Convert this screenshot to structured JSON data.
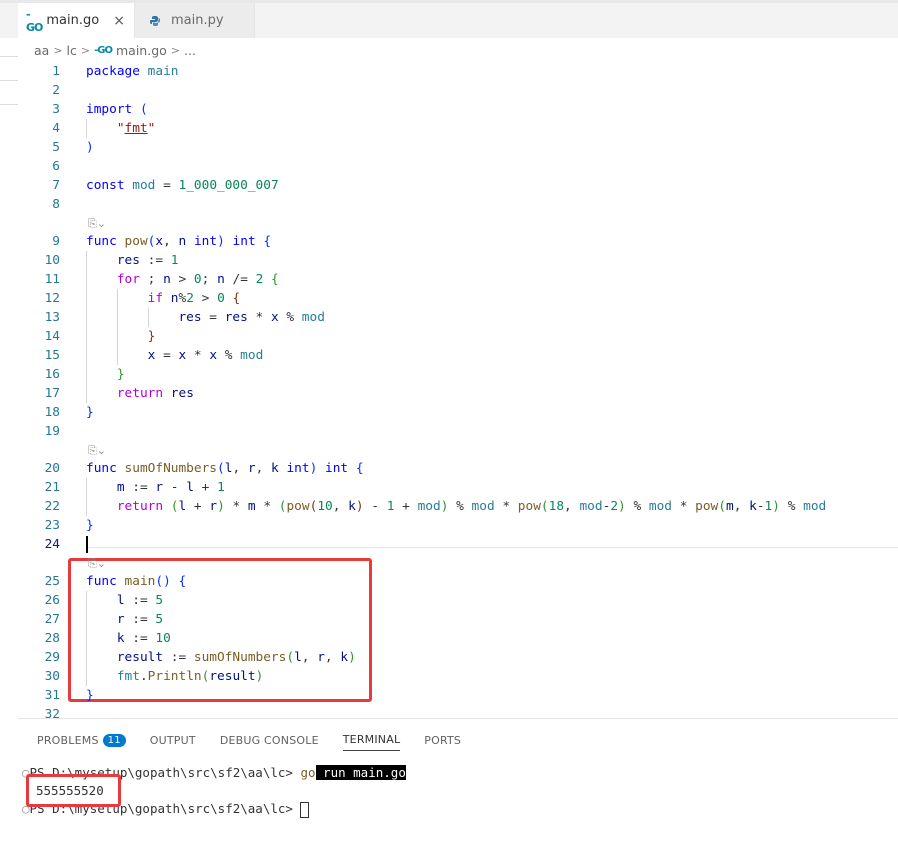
{
  "tabs": [
    {
      "icon": "go-file-icon",
      "icon_text": "-GO",
      "label": "main.go",
      "close": "×"
    },
    {
      "icon": "python-file-icon",
      "label": "main.py"
    }
  ],
  "breadcrumb": {
    "items": [
      "aa",
      "lc",
      "main.go",
      "..."
    ],
    "go_icon_text": "-GO",
    "sep": ">"
  },
  "codelens": {
    "icon_text": "⎘⌄"
  },
  "code_lines": [
    {
      "n": "1",
      "html": "<span class='kw'>package</span> <span class='typ'>main</span>"
    },
    {
      "n": "2",
      "html": ""
    },
    {
      "n": "3",
      "html": "<span class='kw'>import</span> <span class='br1'>(</span>"
    },
    {
      "n": "4",
      "html": "    <span class='str'>\"<u>fmt</u>\"</span>"
    },
    {
      "n": "5",
      "html": "<span class='br1'>)</span>"
    },
    {
      "n": "6",
      "html": ""
    },
    {
      "n": "7",
      "html": "<span class='kw'>const</span> <span class='typ'>mod</span> = <span class='num'>1_000_000_007</span>"
    },
    {
      "n": "8",
      "html": ""
    },
    {
      "n": "9",
      "html": "<span class='kw'>func</span> <span class='fn'>pow</span><span class='br1'>(</span><span class='var'>x</span>, <span class='var'>n</span> <span class='kw'>int</span><span class='br1'>)</span> <span class='kw'>int</span> <span class='br1'>{</span>"
    },
    {
      "n": "10",
      "html": "    <span class='var'>res</span> := <span class='num'>1</span>"
    },
    {
      "n": "11",
      "html": "    <span class='ctl'>for</span> ; <span class='var'>n</span> &gt; <span class='num'>0</span>; <span class='var'>n</span> /= <span class='num'>2</span> <span class='br2'>{</span>"
    },
    {
      "n": "12",
      "html": "        <span class='ctl'>if</span> <span class='var'>n</span>%<span class='num'>2</span> &gt; <span class='num'>0</span> <span class='br3'>{</span>"
    },
    {
      "n": "13",
      "html": "            <span class='var'>res</span> = <span class='var'>res</span> * <span class='var'>x</span> % <span class='typ'>mod</span>"
    },
    {
      "n": "14",
      "html": "        <span class='br3'>}</span>"
    },
    {
      "n": "15",
      "html": "        <span class='var'>x</span> = <span class='var'>x</span> * <span class='var'>x</span> % <span class='typ'>mod</span>"
    },
    {
      "n": "16",
      "html": "    <span class='br2'>}</span>"
    },
    {
      "n": "17",
      "html": "    <span class='ctl'>return</span> <span class='var'>res</span>"
    },
    {
      "n": "18",
      "html": "<span class='br1'>}</span>"
    },
    {
      "n": "19",
      "html": ""
    },
    {
      "n": "20",
      "html": "<span class='kw'>func</span> <span class='fn'>sumOfNumbers</span><span class='br1'>(</span><span class='var'>l</span>, <span class='var'>r</span>, <span class='var'>k</span> <span class='kw'>int</span><span class='br1'>)</span> <span class='kw'>int</span> <span class='br1'>{</span>"
    },
    {
      "n": "21",
      "html": "    <span class='var'>m</span> := <span class='var'>r</span> - <span class='var'>l</span> + <span class='num'>1</span>"
    },
    {
      "n": "22",
      "html": "    <span class='ctl'>return</span> <span class='br2'>(</span><span class='var'>l</span> + <span class='var'>r</span><span class='br2'>)</span> * <span class='var'>m</span> * <span class='br2'>(</span><span class='fn'>pow</span><span class='br3'>(</span><span class='num'>10</span>, <span class='var'>k</span><span class='br3'>)</span> - <span class='num'>1</span> + <span class='typ'>mod</span><span class='br2'>)</span> % <span class='typ'>mod</span> * <span class='fn'>pow</span><span class='br2'>(</span><span class='num'>18</span>, <span class='typ'>mod</span>-<span class='num'>2</span><span class='br2'>)</span> % <span class='typ'>mod</span> * <span class='fn'>pow</span><span class='br2'>(</span><span class='var'>m</span>, <span class='var'>k</span>-<span class='num'>1</span><span class='br2'>)</span> % <span class='typ'>mod</span>"
    },
    {
      "n": "23",
      "html": "<span class='br1'>}</span>"
    },
    {
      "n": "24",
      "html": ""
    },
    {
      "n": "25",
      "html": "<span class='kw'>func</span> <span class='fn'>main</span><span class='br1'>()</span> <span class='br1'>{</span>"
    },
    {
      "n": "26",
      "html": "    <span class='var'>l</span> := <span class='num'>5</span>"
    },
    {
      "n": "27",
      "html": "    <span class='var'>r</span> := <span class='num'>5</span>"
    },
    {
      "n": "28",
      "html": "    <span class='var'>k</span> := <span class='num'>10</span>"
    },
    {
      "n": "29",
      "html": "    <span class='var'>result</span> := <span class='fn'>sumOfNumbers</span><span class='br2'>(</span><span class='var'>l</span>, <span class='var'>r</span>, <span class='var'>k</span><span class='br2'>)</span>"
    },
    {
      "n": "30",
      "html": "    <span class='typ'>fmt</span>.<span class='fn'>Println</span><span class='br2'>(</span><span class='var'>result</span><span class='br2'>)</span>"
    },
    {
      "n": "31",
      "html": "<span class='br1'>}</span>"
    },
    {
      "n": "32",
      "html": ""
    }
  ],
  "panel": {
    "tabs": [
      "PROBLEMS",
      "OUTPUT",
      "DEBUG CONSOLE",
      "TERMINAL",
      "PORTS"
    ],
    "problems_count": "11",
    "active_tab": "TERMINAL"
  },
  "terminal": {
    "prompt1": "PS D:\\mysetup\\gopath\\src\\sf2\\aa\\lc> ",
    "cmd": "go",
    "cmd_args": " run main.go",
    "output": "555555520",
    "prompt2": "PS D:\\mysetup\\gopath\\src\\sf2\\aa\\lc> ",
    "dot": "○"
  }
}
